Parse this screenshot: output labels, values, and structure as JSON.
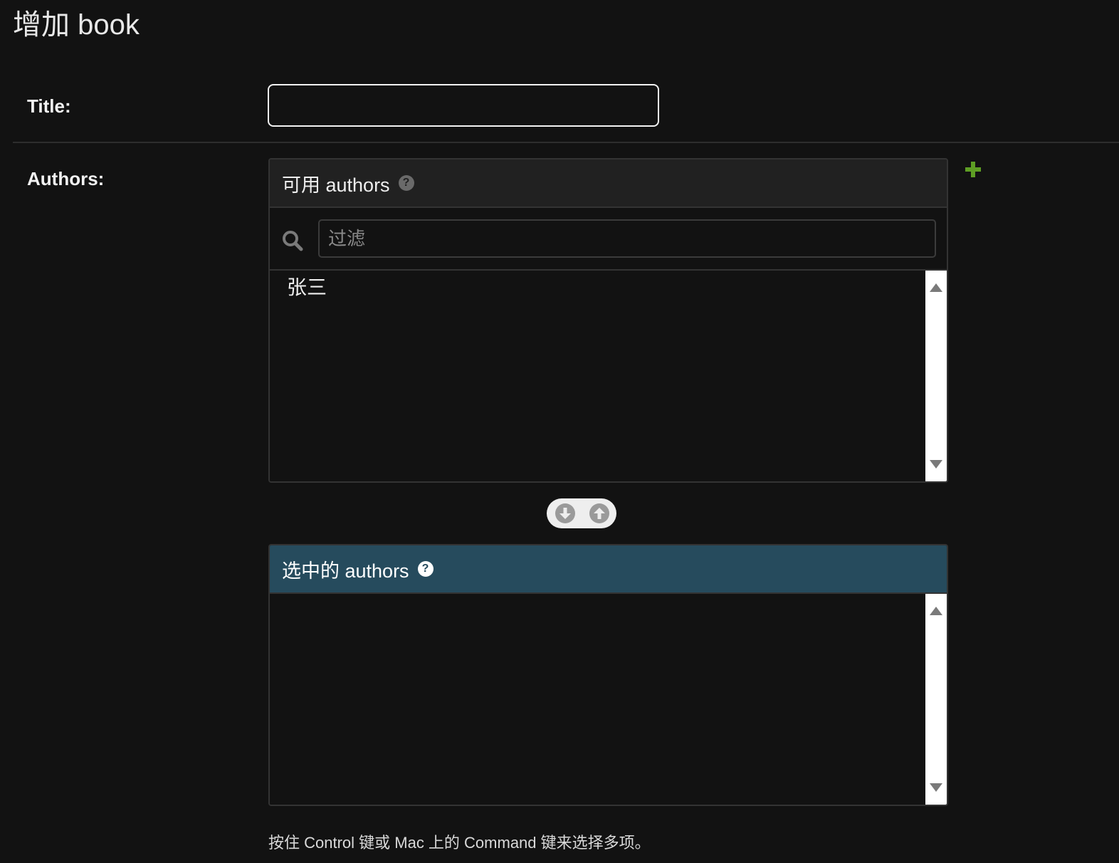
{
  "page": {
    "title": "增加 book"
  },
  "form": {
    "title_label": "Title:",
    "title_value": "",
    "authors_label": "Authors:"
  },
  "available": {
    "header": "可用 authors",
    "help_icon": "question-circle-icon",
    "filter_placeholder": "过滤",
    "search_icon": "search-icon",
    "items": [
      "张三"
    ]
  },
  "chosen": {
    "header": "选中的 authors",
    "help_icon": "question-circle-icon",
    "items": []
  },
  "controls": {
    "add_icon": "plus-icon",
    "choose_icon": "arrow-down-circle-icon",
    "remove_icon": "arrow-up-circle-icon"
  },
  "help": {
    "text": "按住 Control 键或 Mac 上的 Command 键来选择多项。"
  },
  "colors": {
    "background": "#121212",
    "available_header": "#212121",
    "chosen_header": "#264b5d",
    "add_icon": "#5e9e24"
  }
}
